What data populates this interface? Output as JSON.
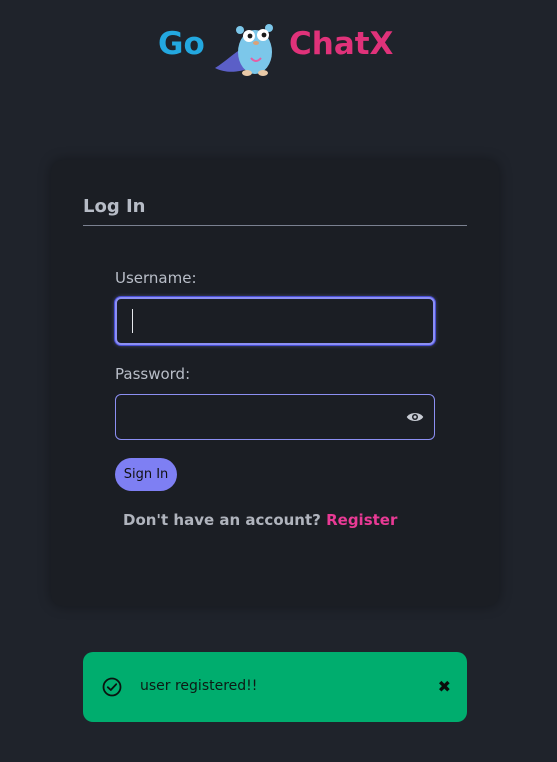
{
  "header": {
    "logo_left": "Go",
    "logo_right": "ChatX",
    "mascot_icon": "gopher-icon"
  },
  "login": {
    "title": "Log In",
    "username_label": "Username:",
    "username_value": "",
    "password_label": "Password:",
    "password_value": "",
    "password_toggle_icon": "eye-icon",
    "signin_label": "Sign In",
    "register_prompt": "Don't have an account?",
    "register_link": "Register"
  },
  "toast": {
    "icon": "check-circle-icon",
    "message": "user registered!!",
    "close_label": "✖"
  },
  "colors": {
    "background": "#1f232b",
    "card": "#1b1e24",
    "accent": "#8c8ff2",
    "go_blue": "#23a8e0",
    "chatx_pink": "#e0327a",
    "register_pink": "#e93a95",
    "toast_green": "#00ad6e"
  }
}
